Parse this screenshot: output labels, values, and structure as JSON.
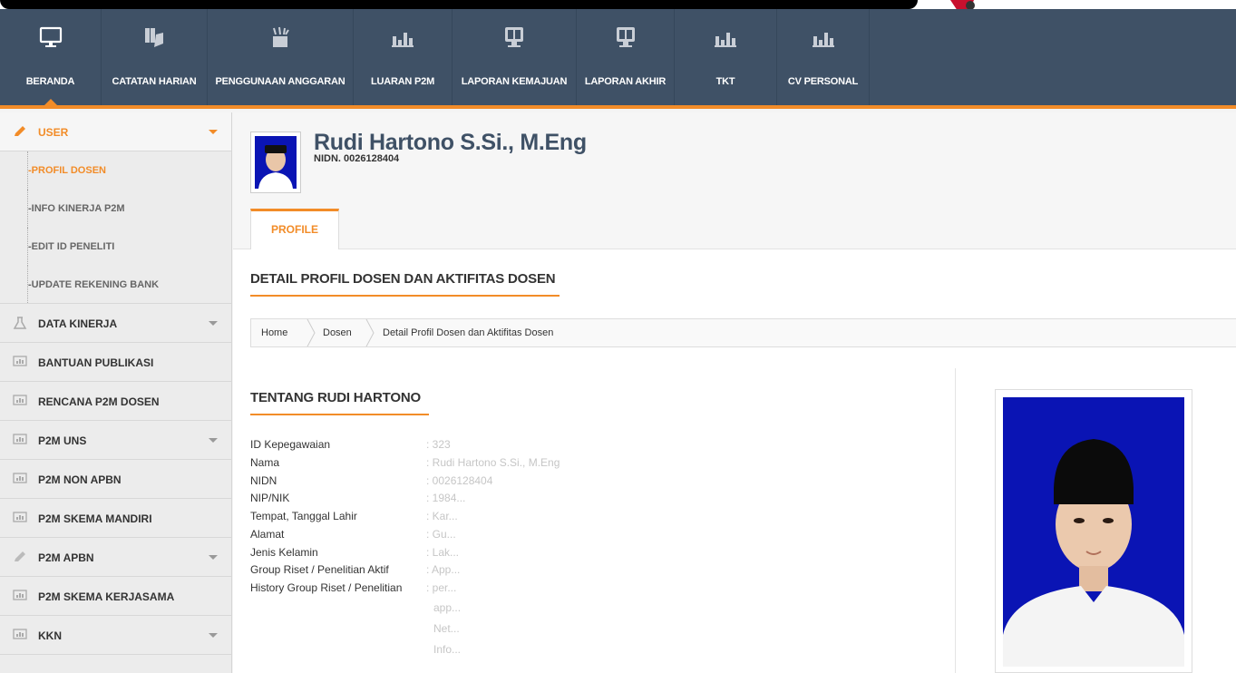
{
  "nav": {
    "items": [
      {
        "label": "BERANDA",
        "icon": "monitor-icon"
      },
      {
        "label": "CATATAN HARIAN",
        "icon": "hand-notes-icon"
      },
      {
        "label": "PENGGUNAAN ANGGARAN",
        "icon": "budget-icon"
      },
      {
        "label": "LUARAN P2M",
        "icon": "bar-chart-icon"
      },
      {
        "label": "LAPORAN KEMAJUAN",
        "icon": "report-screen-icon"
      },
      {
        "label": "LAPORAN AKHIR",
        "icon": "report-screen-icon"
      },
      {
        "label": "TKT",
        "icon": "bar-chart-icon"
      },
      {
        "label": "CV PERSONAL",
        "icon": "bar-chart-icon"
      }
    ],
    "active": "BERANDA"
  },
  "sidebar": {
    "user": {
      "label": "USER",
      "icon": "pencil-icon"
    },
    "user_subitems": [
      "PROFIL DOSEN",
      "INFO KINERJA P2M",
      "EDIT ID PENELITI",
      "UPDATE REKENING BANK"
    ],
    "items": [
      {
        "label": "DATA KINERJA",
        "icon": "flask-icon",
        "has_caret": true
      },
      {
        "label": "BANTUAN PUBLIKASI",
        "icon": "chart-box-icon",
        "has_caret": false
      },
      {
        "label": "RENCANA P2M DOSEN",
        "icon": "chart-box-icon",
        "has_caret": false
      },
      {
        "label": "P2M UNS",
        "icon": "chart-box-icon",
        "has_caret": true
      },
      {
        "label": "P2M NON APBN",
        "icon": "chart-box-icon",
        "has_caret": false
      },
      {
        "label": "P2M SKEMA MANDIRI",
        "icon": "chart-box-icon",
        "has_caret": false
      },
      {
        "label": "P2M APBN",
        "icon": "pencil-icon",
        "has_caret": true
      },
      {
        "label": "P2M SKEMA KERJASAMA",
        "icon": "chart-box-icon",
        "has_caret": false
      },
      {
        "label": "KKN",
        "icon": "chart-box-icon",
        "has_caret": true
      }
    ]
  },
  "profile": {
    "name": "Rudi Hartono S.Si., M.Eng",
    "nidn": "NIDN. 0026128404",
    "tab": "PROFILE"
  },
  "section_title": "DETAIL PROFIL DOSEN DAN AKTIFITAS DOSEN",
  "breadcrumb": [
    "Home",
    "Dosen",
    "Detail Profil Dosen dan Aktifitas Dosen"
  ],
  "about": {
    "title": "TENTANG RUDI HARTONO",
    "fields": [
      {
        "key": "ID Kepegawaian",
        "value": ": 323"
      },
      {
        "key": "Nama",
        "value": ": Rudi Hartono S.Si., M.Eng"
      },
      {
        "key": "NIDN",
        "value": ": 0026128404"
      },
      {
        "key": "NIP/NIK",
        "value": ": 1984..."
      },
      {
        "key": "Tempat, Tanggal Lahir",
        "value": ": Kar..."
      },
      {
        "key": "Alamat",
        "value": ": Gu..."
      },
      {
        "key": "Jenis Kelamin",
        "value": ": Lak..."
      },
      {
        "key": "Group Riset / Penelitian Aktif",
        "value": ": App..."
      },
      {
        "key": "History Group Riset / Penelitian",
        "value": ": per..."
      }
    ],
    "history_extra": [
      "app...",
      "Net...",
      "Info..."
    ]
  },
  "colors": {
    "accent": "#f28c28",
    "nav_bg": "#3f5166",
    "photo_bg": "#0a14b4"
  }
}
